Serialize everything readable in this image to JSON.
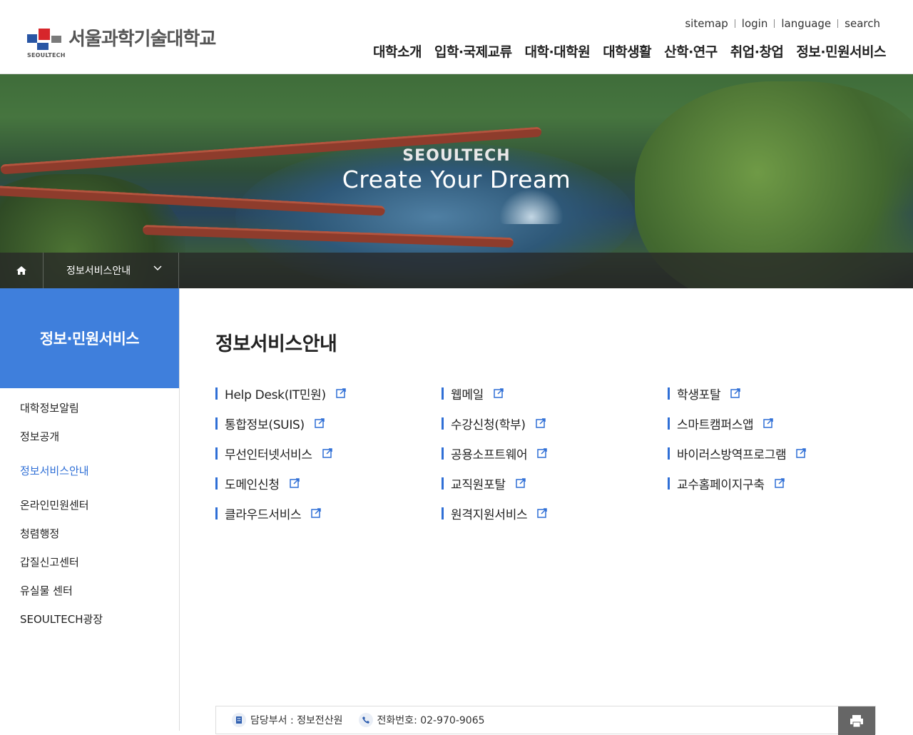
{
  "logo": {
    "name": "서울과학기술대학교",
    "sub": "SEOULTECH"
  },
  "util": [
    "sitemap",
    "login",
    "language",
    "search"
  ],
  "gnb": [
    "대학소개",
    "입학·국제교류",
    "대학·대학원",
    "대학생활",
    "산학·연구",
    "취업·창업",
    "정보·민원서비스"
  ],
  "hero": {
    "tag": "SEOULTECH",
    "title": "Create Your Dream"
  },
  "breadcrumb": {
    "current": "정보서비스안내"
  },
  "sidebar": {
    "title": "정보·민원서비스",
    "items": [
      {
        "label": "대학정보알림"
      },
      {
        "label": "정보공개"
      },
      {
        "label": "정보서비스안내",
        "active": true
      },
      {
        "label": "온라인민원센터"
      },
      {
        "label": "청렴행정"
      },
      {
        "label": "갑질신고센터"
      },
      {
        "label": "유실물 센터"
      },
      {
        "label": "SEOULTECH광장"
      }
    ]
  },
  "content": {
    "title": "정보서비스안내",
    "links": [
      "Help Desk(IT민원)",
      "웹메일",
      "학생포탈",
      "통합정보(SUIS)",
      "수강신청(학부)",
      "스마트캠퍼스앱",
      "무선인터넷서비스",
      "공용소프트웨어",
      "바이러스방역프로그램",
      "도메인신청",
      "교직원포탈",
      "교수홈페이지구축",
      "클라우드서비스",
      "원격지원서비스"
    ]
  },
  "footer": {
    "dept": "담당부서 : 정보전산원",
    "phone": "전화번호: 02-970-9065"
  },
  "colors": {
    "accent": "#3f7fdc",
    "link_bar": "#2f6fd6"
  }
}
